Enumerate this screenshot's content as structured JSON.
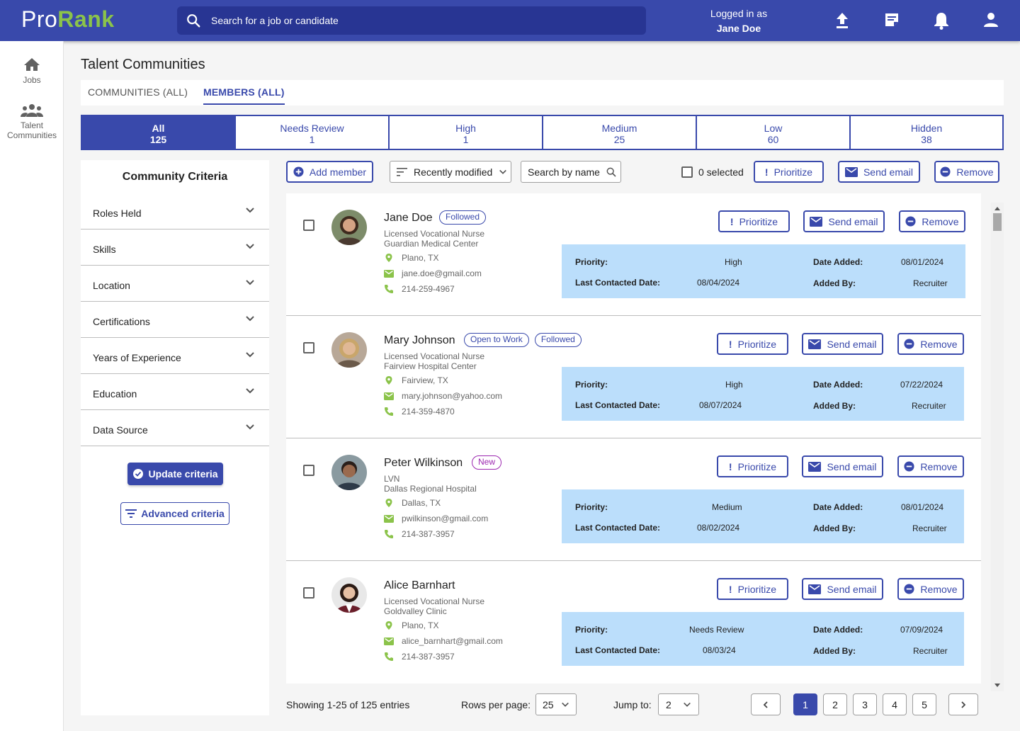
{
  "app": {
    "logo_part1": "Pro",
    "logo_part2": "Rank",
    "brand_color": "#3949ab",
    "accent_color": "#8bc34a"
  },
  "header": {
    "search_placeholder": "Search for a job or candidate",
    "logged_in_label": "Logged in as",
    "user_name": "Jane Doe",
    "icons": [
      "upload-icon",
      "notes-icon",
      "bell-icon",
      "account-icon"
    ]
  },
  "sidebar": {
    "items": [
      {
        "label": "Jobs",
        "icon": "home-icon"
      },
      {
        "label": "Talent Communities",
        "icon": "group-icon"
      }
    ]
  },
  "page": {
    "title": "Talent Communities"
  },
  "tabs": [
    {
      "label": "COMMUNITIES (ALL)",
      "active": false
    },
    {
      "label": "MEMBERS (ALL)",
      "active": true
    }
  ],
  "filters": [
    {
      "label": "All",
      "count": "125",
      "active": true
    },
    {
      "label": "Needs Review",
      "count": "1"
    },
    {
      "label": "High",
      "count": "1"
    },
    {
      "label": "Medium",
      "count": "25"
    },
    {
      "label": "Low",
      "count": "60"
    },
    {
      "label": "Hidden",
      "count": "38"
    }
  ],
  "criteria": {
    "title": "Community Criteria",
    "items": [
      "Roles Held",
      "Skills",
      "Location",
      "Certifications",
      "Years of Experience",
      "Education",
      "Data Source"
    ],
    "update_label": "Update criteria",
    "advanced_label": "Advanced criteria"
  },
  "toolbar": {
    "add_member": "Add member",
    "sort_value": "Recently modified",
    "search_placeholder": "Search by name",
    "selected_text": "0 selected",
    "prioritize": "Prioritize",
    "send_email": "Send email",
    "remove": "Remove"
  },
  "labels": {
    "priority": "Priority:",
    "last_contacted": "Last Contacted Date:",
    "date_added": "Date Added:",
    "added_by": "Added By:"
  },
  "members": [
    {
      "name": "Jane Doe",
      "badges": [
        "Followed"
      ],
      "title": "Licensed Vocational Nurse",
      "org": "Guardian Medical Center",
      "location": "Plano, TX",
      "email": "jane.doe@gmail.com",
      "phone": "214-259-4967",
      "priority": "High",
      "last_contacted": "08/04/2024",
      "date_added": "08/01/2024",
      "added_by": "Recruiter"
    },
    {
      "name": "Mary Johnson",
      "badges": [
        "Open to Work",
        "Followed"
      ],
      "title": "Licensed Vocational Nurse",
      "org": "Fairview Hospital Center",
      "location": "Fairview, TX",
      "email": "mary.johnson@yahoo.com",
      "phone": "214-359-4870",
      "priority": "High",
      "last_contacted": "08/07/2024",
      "date_added": "07/22/2024",
      "added_by": "Recruiter"
    },
    {
      "name": "Peter Wilkinson",
      "badges": [
        "New"
      ],
      "title": "LVN",
      "org": "Dallas Regional Hospital",
      "location": "Dallas, TX",
      "email": "pwilkinson@gmail.com",
      "phone": "214-387-3957",
      "priority": "Medium",
      "last_contacted": "08/02/2024",
      "date_added": "08/01/2024",
      "added_by": "Recruiter"
    },
    {
      "name": "Alice Barnhart",
      "badges": [],
      "title": "Licensed Vocational Nurse",
      "org": "Goldvalley Clinic",
      "location": "Plano, TX",
      "email": "alice_barnhart@gmail.com",
      "phone": "214-387-3957",
      "priority": "Needs Review",
      "last_contacted": "08/03/24",
      "date_added": "07/09/2024",
      "added_by": "Recruiter"
    }
  ],
  "pagination": {
    "showing": "Showing 1-25 of 125 entries",
    "rows_label": "Rows per page:",
    "rows_value": "25",
    "jump_label": "Jump to:",
    "jump_value": "2",
    "pages": [
      "1",
      "2",
      "3",
      "4",
      "5"
    ],
    "current_page": "1"
  }
}
